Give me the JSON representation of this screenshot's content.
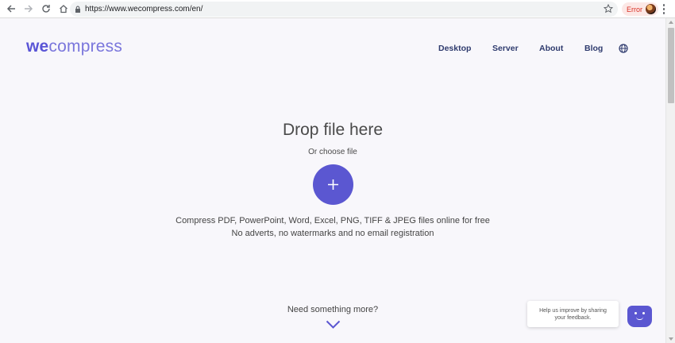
{
  "browser": {
    "url": "https://www.wecompress.com/en/",
    "error_label": "Error"
  },
  "header": {
    "logo": {
      "bold": "we",
      "regular": "compress"
    },
    "nav": [
      "Desktop",
      "Server",
      "About",
      "Blog"
    ],
    "language_icon": "globe-icon"
  },
  "main": {
    "title": "Drop file here",
    "subtitle": "Or choose file",
    "add_icon": "plus-icon",
    "description_line1": "Compress PDF, PowerPoint, Word, Excel, PNG, TIFF & JPEG files online for free",
    "description_line2": "No adverts, no watermarks and no email registration",
    "more_label": "Need something more?"
  },
  "feedback": {
    "line1": "Help us improve by sharing",
    "line2": "your feedback."
  },
  "colors": {
    "accent": "#5b57d1",
    "background": "#f8f7fb",
    "nav_text": "#2f3b6e"
  }
}
